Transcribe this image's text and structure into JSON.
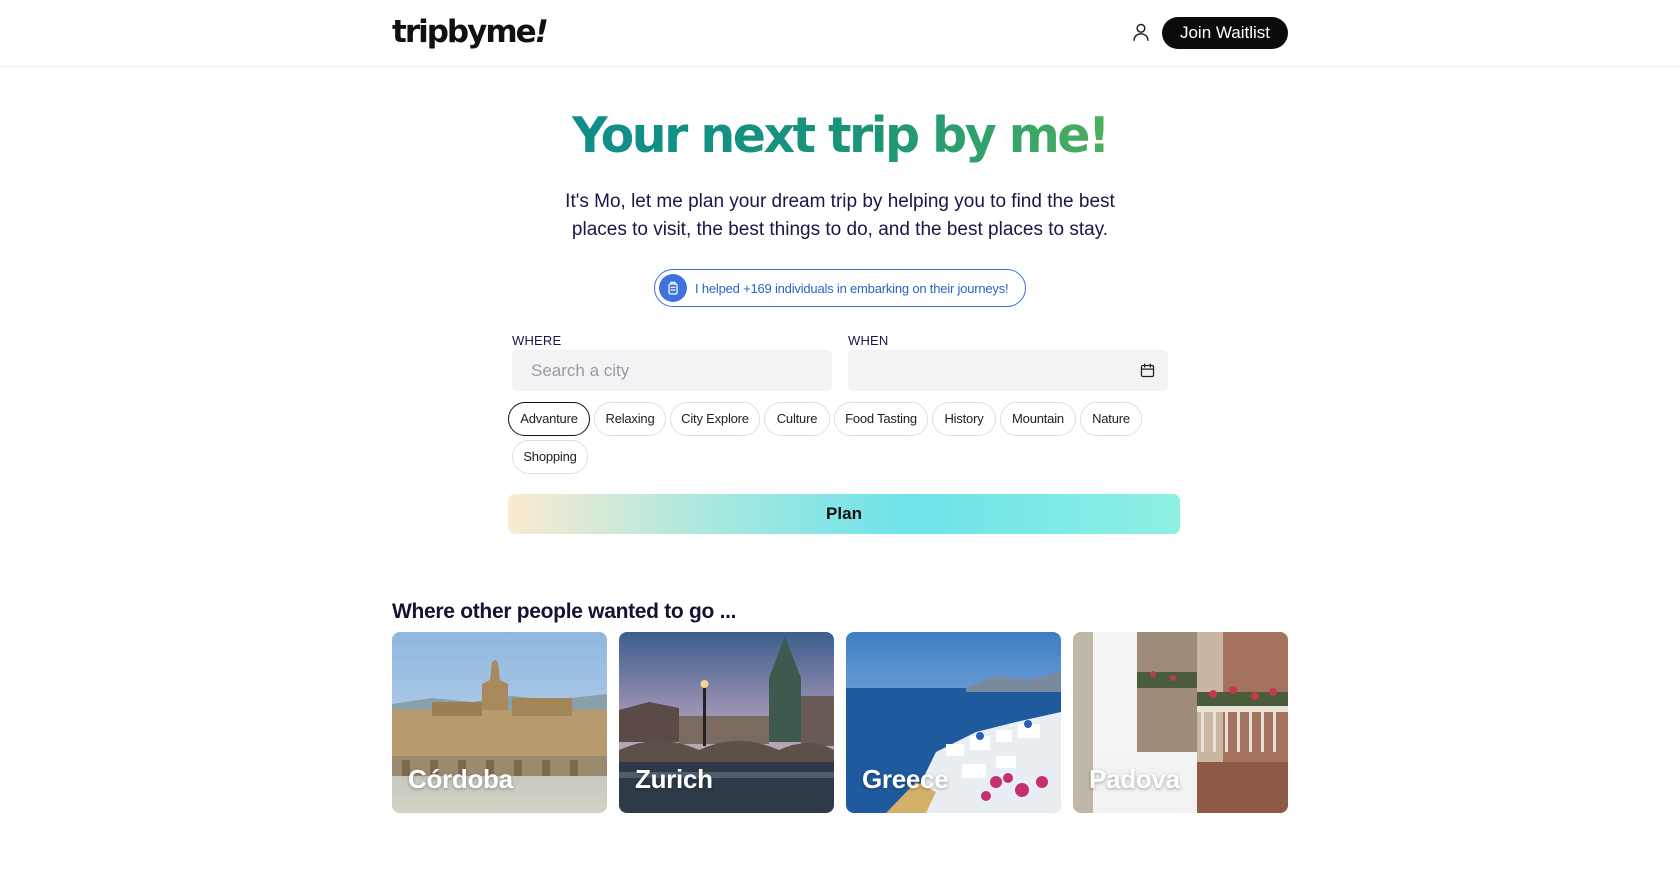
{
  "header": {
    "logo_text": "tripbyme",
    "logo_bang": "!",
    "join_label": "Join Waitlist"
  },
  "hero": {
    "title": "Your next trip by me!",
    "subtitle": "It's Mo, let me plan your dream trip by helping you to find the best places to visit, the best things to do, and the best places to stay.",
    "badge_text": "I helped +169 individuals in embarking on their journeys!"
  },
  "form": {
    "where_label": "WHERE",
    "where_placeholder": "Search a city",
    "where_value": "",
    "when_label": "WHEN",
    "when_value": "",
    "selected_interest": "Advanture",
    "interests": [
      "Advanture",
      "Relaxing",
      "City Explore",
      "Culture",
      "Food Tasting",
      "History",
      "Mountain",
      "Nature",
      "Shopping"
    ],
    "plan_label": "Plan"
  },
  "destinations": {
    "title": "Where other people wanted to go ...",
    "items": [
      {
        "label": "Córdoba"
      },
      {
        "label": "Zurich"
      },
      {
        "label": "Greece"
      },
      {
        "label": "Padova"
      }
    ]
  },
  "colors": {
    "brand_gradient_start": "#0f8d8a",
    "brand_gradient_end": "#4cae5e",
    "badge_blue": "#3b6fd6",
    "text_dark": "#1e1446"
  }
}
